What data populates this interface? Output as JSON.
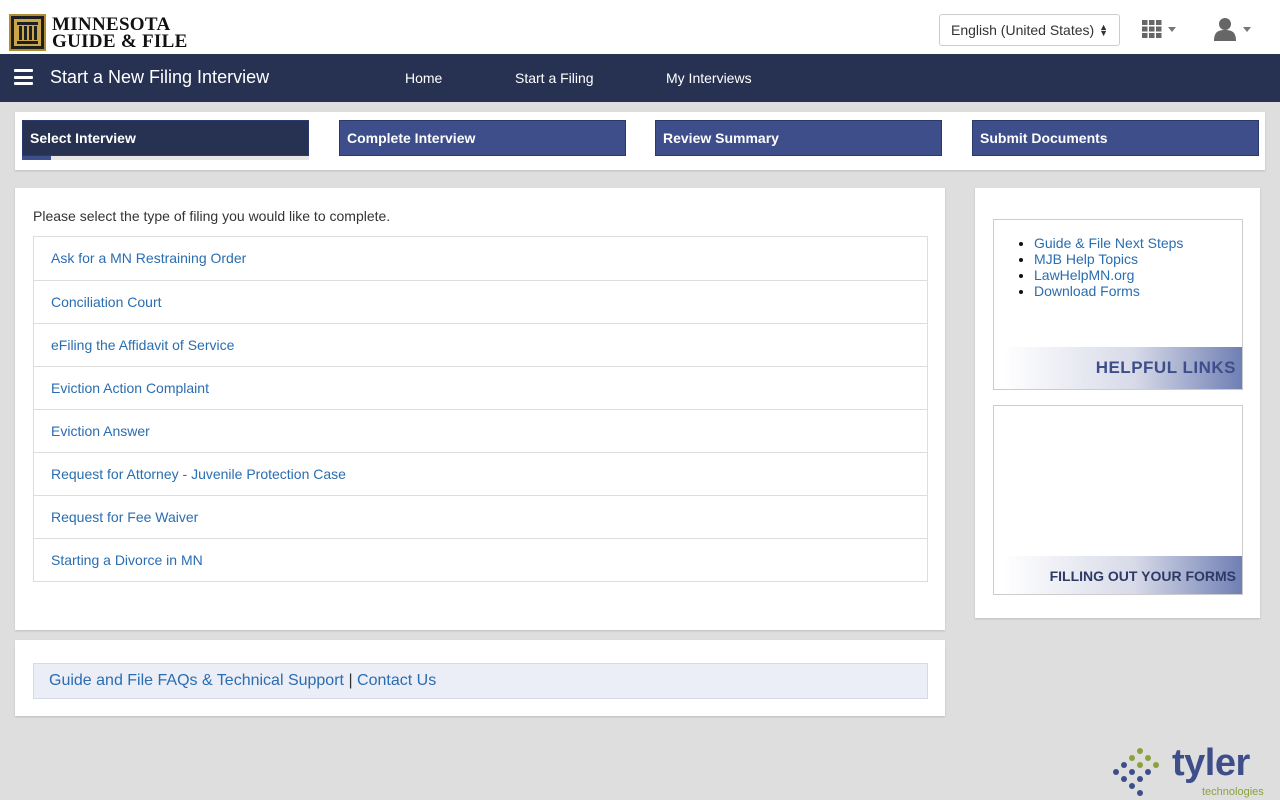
{
  "header": {
    "logo_line1": "MINNESOTA",
    "logo_line2": "GUIDE & FILE",
    "language": "English (United States)"
  },
  "navbar": {
    "title": "Start a New Filing Interview",
    "links": [
      "Home",
      "Start a Filing",
      "My Interviews"
    ]
  },
  "steps": [
    {
      "label": "Select Interview",
      "active": true
    },
    {
      "label": "Complete Interview",
      "active": false
    },
    {
      "label": "Review Summary",
      "active": false
    },
    {
      "label": "Submit Documents",
      "active": false
    }
  ],
  "main": {
    "prompt": "Please select the type of filing you would like to complete.",
    "items": [
      "Ask for a MN Restraining Order",
      "Conciliation Court",
      "eFiling the Affidavit of Service",
      "Eviction Action Complaint",
      "Eviction Answer",
      "Request for Attorney - Juvenile Protection Case",
      "Request for Fee Waiver",
      "Starting a Divorce in MN"
    ]
  },
  "footer": {
    "faq_link": "Guide and File FAQs & Technical Support",
    "separator": "|",
    "contact_link": "Contact Us"
  },
  "sidebar": {
    "helpful_links": [
      "Guide & File Next Steps",
      "MJB Help Topics",
      "LawHelpMN.org",
      "Download Forms"
    ],
    "helpful_links_title": "HELPFUL LINKS",
    "forms_title": "FILLING OUT YOUR FORMS"
  },
  "branding": {
    "vendor_name": "tyler",
    "vendor_sub": "technologies"
  },
  "colors": {
    "navbar": "#273253",
    "step": "#3d4e8a",
    "link": "#2a6db0",
    "tyler_green": "#8aa23c"
  }
}
